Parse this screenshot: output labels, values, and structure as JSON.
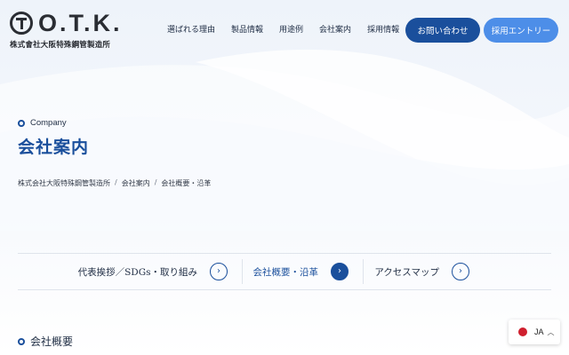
{
  "header": {
    "logo_text": "O.T.K.",
    "logo_subtitle": "株式會社大阪特殊鋼管製造所",
    "nav": [
      "選ばれる理由",
      "製品情報",
      "用途例",
      "会社案内",
      "採用情報"
    ],
    "contact_button": "お問い合わせ",
    "recruit_button": "採用エントリー"
  },
  "hero": {
    "eyebrow": "Company",
    "title": "会社案内",
    "breadcrumb": [
      "株式会社大阪特殊鋼管製造所",
      "会社案内",
      "会社概要・沿革"
    ],
    "breadcrumb_separator": "/"
  },
  "tabs": [
    {
      "label": "代表挨拶／SDGs・取り組み",
      "icon": "chevron-right-icon",
      "active": false
    },
    {
      "label": "会社概要・沿革",
      "icon": "chevron-right-icon",
      "active": true
    },
    {
      "label": "アクセスマップ",
      "icon": "chevron-right-icon",
      "active": false
    }
  ],
  "section": {
    "title": "会社概要"
  },
  "language": {
    "code": "JA",
    "flag": "japan-flag-icon",
    "caret": "chevron-up-icon"
  },
  "colors": {
    "primary": "#1a4f9c",
    "accent": "#4d8ee8",
    "flag_red": "#cf1f2e"
  }
}
